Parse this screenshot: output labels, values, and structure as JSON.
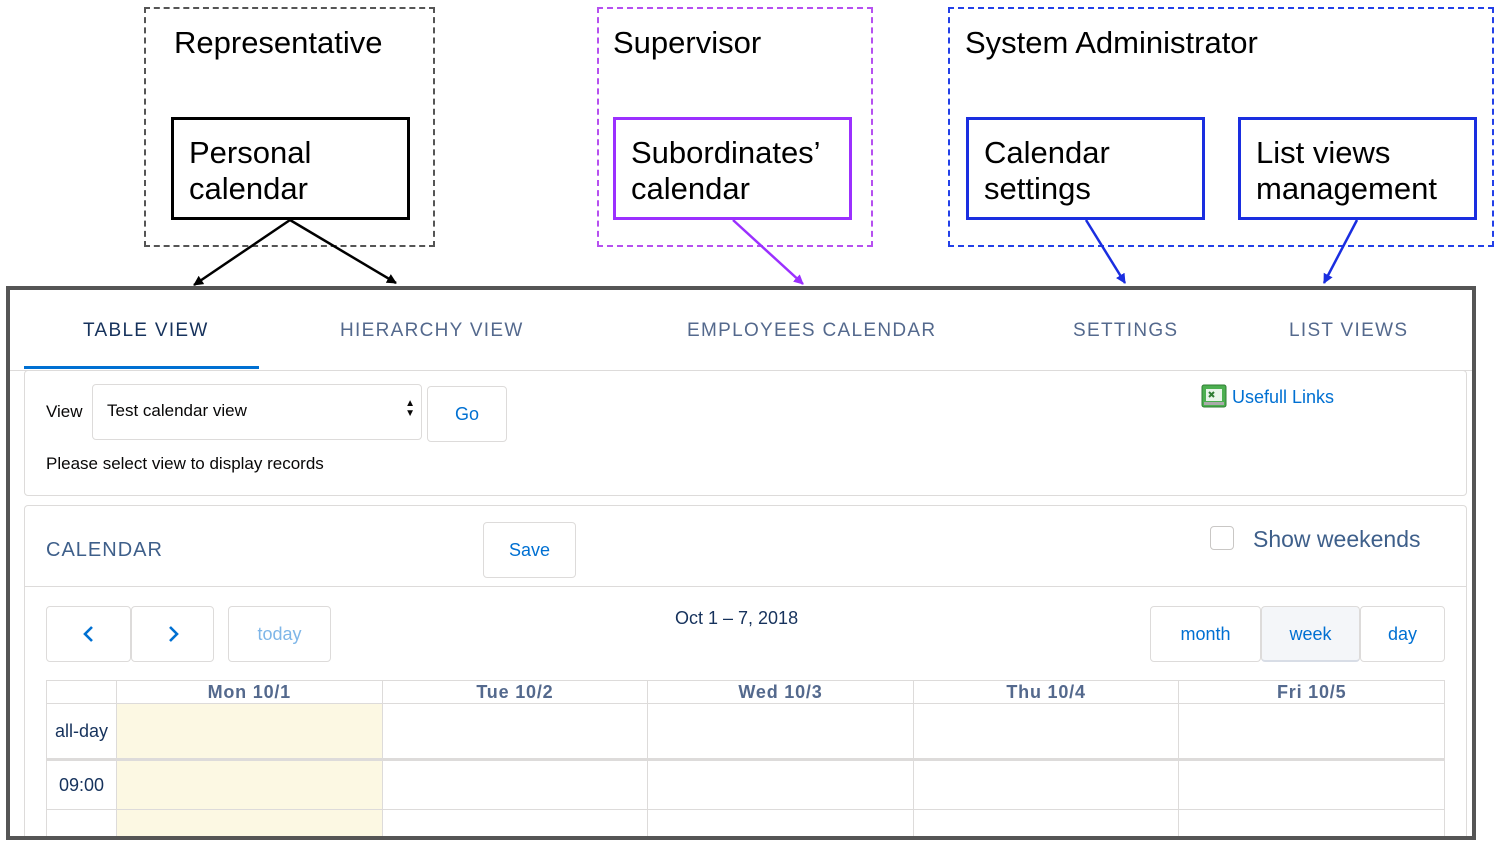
{
  "roles": [
    {
      "title": "Representative",
      "features": [
        [
          "Personal",
          "calendar"
        ]
      ]
    },
    {
      "title": "Supervisor",
      "features": [
        [
          "Subordinates’",
          "calendar"
        ]
      ]
    },
    {
      "title": "System Administrator",
      "features": [
        [
          "Calendar",
          "settings"
        ],
        [
          "List views",
          "management"
        ]
      ]
    }
  ],
  "colors": {
    "representative": "#000000",
    "supervisor": "#9b30ff",
    "admin": "#1a2ee0",
    "accent": "#0070d2"
  },
  "tabs": [
    "TABLE VIEW",
    "HIERARCHY VIEW",
    "EMPLOYEES CALENDAR",
    "SETTINGS",
    "LIST VIEWS"
  ],
  "view_panel": {
    "view_label": "View",
    "selected_view": "Test calendar view",
    "go_label": "Go",
    "useful_links": "Usefull Links",
    "message": "Please select view to display records"
  },
  "calendar": {
    "title": "CALENDAR",
    "save_label": "Save",
    "show_weekends_label": "Show weekends",
    "show_weekends_checked": false,
    "prev_icon": "chevron-left-icon",
    "next_icon": "chevron-right-icon",
    "today_label": "today",
    "date_range": "Oct 1 – 7, 2018",
    "views": [
      "month",
      "week",
      "day"
    ],
    "selected_view": "week",
    "days": [
      "Mon 10/1",
      "Tue 10/2",
      "Wed 10/3",
      "Thu 10/4",
      "Fri 10/5"
    ],
    "allday_label": "all-day",
    "times": [
      "09:00"
    ]
  }
}
